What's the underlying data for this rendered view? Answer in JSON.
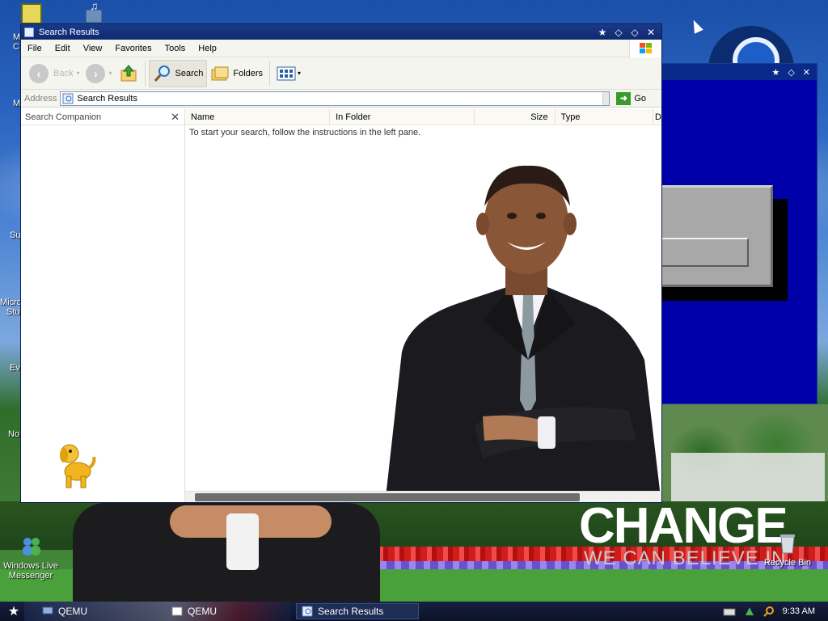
{
  "desktop": {
    "icons": [
      {
        "label": "Windows Live Messenger"
      },
      {
        "label": "Recycle Bin"
      }
    ],
    "partial_labels": [
      "M",
      "C",
      "M",
      "Su",
      "Micro",
      "Stu",
      "Ev",
      "No"
    ],
    "wallpaper_text": {
      "headline": "CHANGE",
      "tagline": "WE CAN BELIEVE IN"
    }
  },
  "window": {
    "title": "Search Results",
    "title_controls": [
      "★",
      "◇",
      "◇",
      "✕"
    ],
    "menu": [
      "File",
      "Edit",
      "View",
      "Favorites",
      "Tools",
      "Help"
    ],
    "toolbar": {
      "back_label": "Back",
      "search_label": "Search",
      "folders_label": "Folders"
    },
    "address": {
      "label": "Address",
      "value": "Search Results",
      "go_label": "Go"
    },
    "left_pane": {
      "title": "Search Companion",
      "close": "✕"
    },
    "columns": [
      "Name",
      "In Folder",
      "Size",
      "Type",
      "D"
    ],
    "message": "To start your search, follow the instructions in the left pane."
  },
  "right_window": {
    "title_controls": [
      "★",
      "◇",
      "✕"
    ]
  },
  "taskbar": {
    "start": "★",
    "items": [
      {
        "label": "QEMU"
      },
      {
        "label": "QEMU"
      },
      {
        "label": "Search Results"
      }
    ],
    "clock": "9:33 AM"
  },
  "colors": {
    "title_bar": "#0f2a6e",
    "blue_window": "#0000a8",
    "taskbar": "#0b1228",
    "go_green": "#3a9a2a"
  },
  "icons": [
    "back-icon",
    "forward-icon",
    "up-folder-icon",
    "search-icon",
    "folders-icon",
    "views-icon",
    "go-arrow-icon",
    "search-dog-icon",
    "messenger-icon",
    "recycle-bin-icon",
    "windows-flag-icon"
  ]
}
